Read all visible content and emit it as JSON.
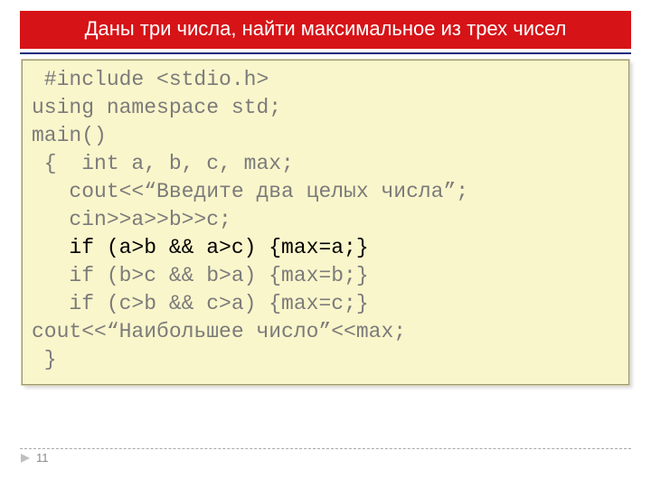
{
  "title": "Даны три числа, найти максимальное из трех чисел",
  "code": {
    "l0": " #include <stdio.h>",
    "l1": "using namespace std;",
    "l2": "main()",
    "l3": " {  int a, b, c, max;",
    "l4": "   cout<<“Введите два целых числа”;",
    "l5": "   cin>>a>>b>>c;",
    "l6": "   if (a>b && a>c) {max=a;}",
    "l7": "   if (b>c && b>a) {max=b;}",
    "l8": "   if (c>b && c>a) {max=c;}",
    "l9": "cout<<“Наибольшее число”<<max;",
    "l10": " }"
  },
  "footer": {
    "page_number": "11"
  },
  "icons": {
    "play": "play-icon"
  },
  "colors": {
    "title_bg": "#d61317",
    "code_bg": "#faf6cb",
    "rule": "#152d7d"
  }
}
